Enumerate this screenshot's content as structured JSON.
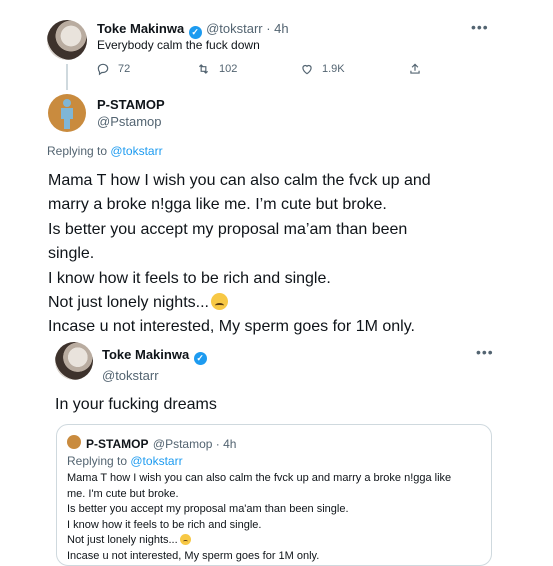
{
  "tweet1": {
    "name": "Toke Makinwa",
    "handle_time": "@tokstarr · 4h",
    "text": "Everybody calm the fuck down",
    "replies": "72",
    "retweets": "102",
    "likes": "1.9K"
  },
  "reply": {
    "name": "P-STAMOP",
    "handle": "@Pstamop",
    "replying_to_prefix": "Replying to ",
    "replying_to_user": "@tokstarr",
    "lines": [
      "Mama T how I wish you can also calm the fvck up and",
      "marry a broke n!gga like me. I’m cute but broke.",
      "Is better you accept my proposal ma’am than been",
      "single.",
      "I know how it feels to be rich and single.",
      "Not just lonely nights...",
      "Incase u not interested, My sperm goes for 1M only."
    ]
  },
  "tweet2": {
    "name": "Toke Makinwa",
    "handle": "@tokstarr",
    "text": "In your fucking dreams"
  },
  "quote": {
    "name": "P-STAMOP",
    "handle_time": "@Pstamop · 4h",
    "replying_to_prefix": "Replying to ",
    "replying_to_user": "@tokstarr",
    "lines": [
      "Mama T how I wish you can also calm the fvck up and marry a broke n!gga like",
      "me. I'm cute but broke.",
      "Is better you accept my proposal ma'am than been single.",
      "I know how it feels to be rich and single.",
      "Not just lonely nights...",
      "Incase u not interested, My sperm goes for 1M only."
    ]
  },
  "colors": {
    "accent": "#1d9bf0",
    "muted": "#536471",
    "text": "#0f1419"
  },
  "icons": [
    "reply-icon",
    "retweet-icon",
    "like-icon",
    "share-icon",
    "more-icon",
    "verified-icon",
    "crying-emoji"
  ]
}
